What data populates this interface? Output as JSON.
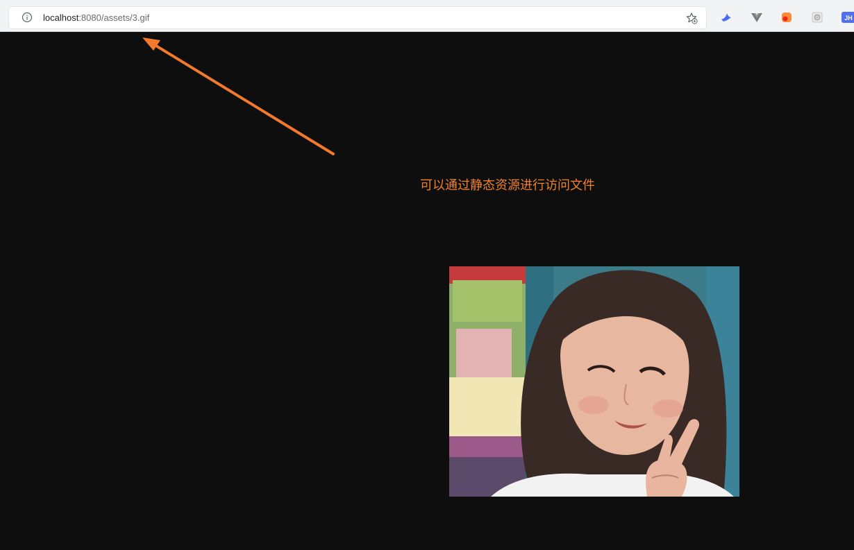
{
  "browser": {
    "url_host": "localhost",
    "url_rest": ":8080/assets/3.gif",
    "extensions": [
      {
        "icon": "bird-extension-icon",
        "color": "#4a6cf7"
      },
      {
        "icon": "vue-devtools-icon",
        "color": "#777777"
      },
      {
        "icon": "orange-extension-icon",
        "color": "#ff6a1f"
      },
      {
        "icon": "gear-extension-icon",
        "color": "#aaaaaa"
      },
      {
        "icon": "jh-extension-icon",
        "label": "JH",
        "color": "#4f6ef2"
      }
    ]
  },
  "page": {
    "annotation_text": "可以通过静态资源进行访问文件",
    "annotation_color": "#f08130",
    "image_description_icon": "gif-image"
  }
}
